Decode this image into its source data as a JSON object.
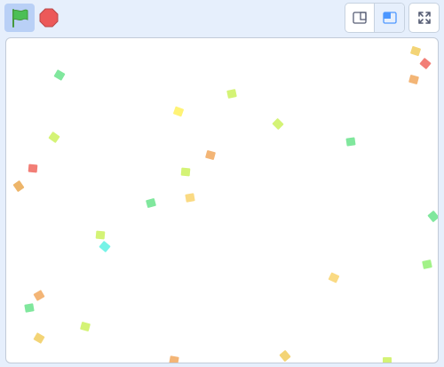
{
  "controls": {
    "green_flag": {
      "icon": "green-flag-icon",
      "color": "#4cbf56",
      "active": true
    },
    "stop": {
      "icon": "stop-sign-icon",
      "color": "#ec5959"
    },
    "stage_modes": {
      "small": {
        "icon": "small-stage-icon",
        "selected": false
      },
      "large": {
        "icon": "large-stage-icon",
        "selected": true
      }
    },
    "fullscreen": {
      "icon": "fullscreen-icon"
    }
  },
  "stage": {
    "background": "#ffffff",
    "confetti_colors": [
      "#f0c850",
      "#ee5a50",
      "#f0a050",
      "#5ce082",
      "#c8f050",
      "#fff050",
      "#e8a040",
      "#4ff0e0",
      "#f9d060",
      "#88ee66"
    ]
  }
}
